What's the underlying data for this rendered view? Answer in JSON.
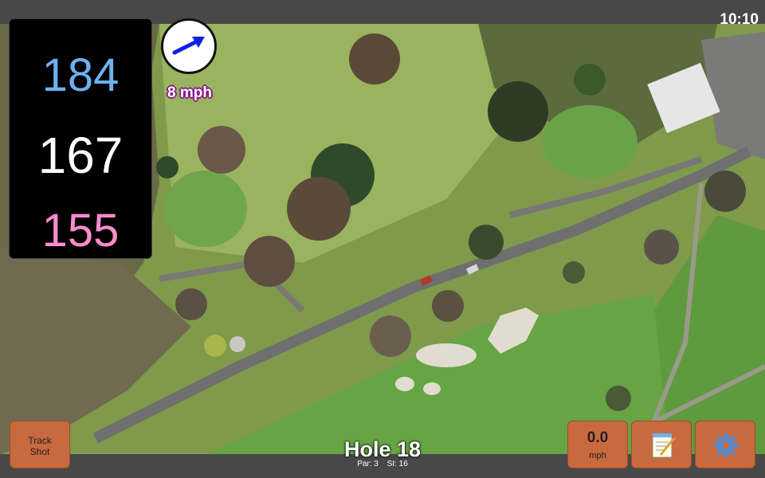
{
  "status_bar": {
    "time": "10:10"
  },
  "distances": {
    "back": "184",
    "middle": "167",
    "front": "155"
  },
  "wind": {
    "speed_label": "8 mph",
    "direction_icon": "wind-arrow-icon"
  },
  "buttons": {
    "track_line1": "Track",
    "track_line2": "Shot",
    "speed_value": "0.0",
    "speed_unit": "mph",
    "notes_icon": "notepad-icon",
    "settings_icon": "gear-icon"
  },
  "hole": {
    "title": "Hole 18",
    "par": "Par: 3",
    "si": "SI: 16"
  },
  "colors": {
    "back": "#6cb1f0",
    "middle": "#ffffff",
    "front": "#ff8ccd",
    "button": "#c8693e"
  }
}
